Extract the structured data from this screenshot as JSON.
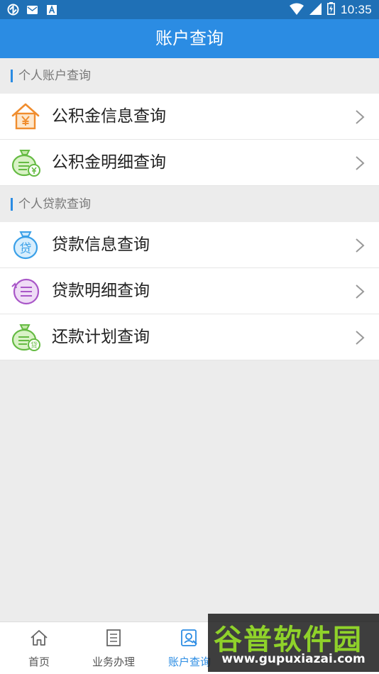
{
  "status_bar": {
    "time": "10:35",
    "left_icons": [
      "sync-icon",
      "mail-icon",
      "font-icon"
    ],
    "right_icons": [
      "wifi-icon",
      "signal-icon",
      "battery-icon"
    ]
  },
  "header": {
    "title": "账户查询"
  },
  "sections": [
    {
      "title": "个人账户查询",
      "items": [
        {
          "label": "公积金信息查询",
          "icon": "house-yuan-icon"
        },
        {
          "label": "公积金明细查询",
          "icon": "money-bag-yuan-icon"
        }
      ]
    },
    {
      "title": "个人贷款查询",
      "items": [
        {
          "label": "贷款信息查询",
          "icon": "loan-bag-icon"
        },
        {
          "label": "贷款明细查询",
          "icon": "loan-detail-icon"
        },
        {
          "label": "还款计划查询",
          "icon": "repayment-bag-icon"
        }
      ]
    }
  ],
  "bottom_nav": {
    "tabs": [
      {
        "label": "首页",
        "icon": "home-icon",
        "active": false
      },
      {
        "label": "业务办理",
        "icon": "document-icon",
        "active": false
      },
      {
        "label": "账户查询",
        "icon": "account-search-icon",
        "active": true
      }
    ]
  },
  "watermark": {
    "title": "谷普软件园",
    "url": "www.gupuxiazai.com"
  },
  "colors": {
    "primary": "#2b8ce3",
    "status_bar": "#1f70b6",
    "background": "#ececec",
    "watermark_green": "#8fd22a"
  }
}
